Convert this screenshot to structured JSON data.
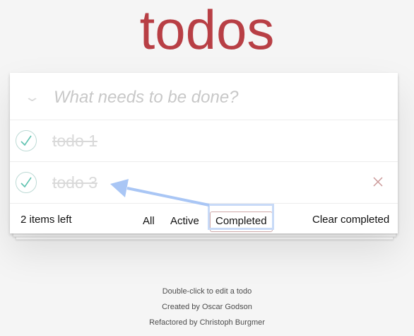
{
  "app": {
    "title": "todos"
  },
  "header": {
    "toggle_all_icon": "chevron-down-icon",
    "new_todo_placeholder": "What needs to be done?"
  },
  "todos": [
    {
      "label": "todo 1",
      "completed": true
    },
    {
      "label": "todo 3",
      "completed": true
    }
  ],
  "footer": {
    "count_text": "2 items left",
    "filters": [
      "All",
      "Active",
      "Completed"
    ],
    "selected_filter": "Completed",
    "clear_label": "Clear completed"
  },
  "info": {
    "line1": "Double-click to edit a todo",
    "line2": "Created by Oscar Godson",
    "line3": "Refactored by Christoph Burgmer"
  },
  "colors": {
    "title": "#b83f45",
    "check": "#5dc2af",
    "destroy": "#cc9a9a",
    "highlight": "#c8daf7",
    "arrow": "#a9c6f5"
  }
}
